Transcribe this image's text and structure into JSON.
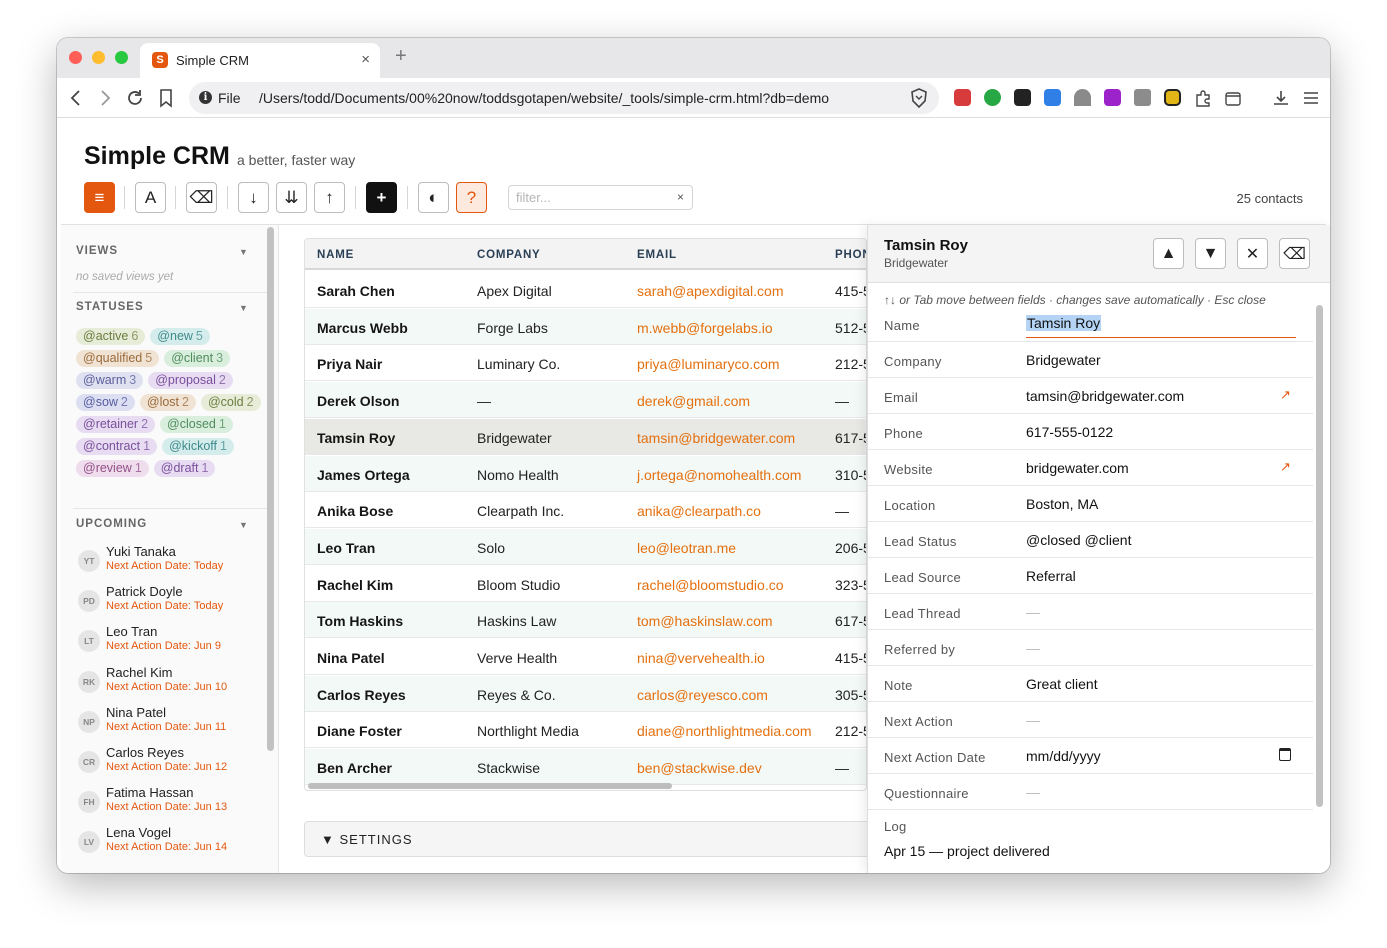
{
  "browser": {
    "tab_title": "Simple CRM",
    "tab_favicon": "S",
    "url_scheme": "File",
    "url": "/Users/todd/Documents/00%20now/toddsgotapen/website/_tools/simple-crm.html?db=demo"
  },
  "app": {
    "title": "Simple CRM",
    "subtitle": "a better, faster way",
    "filter_placeholder": "filter...",
    "contact_count": "25 contacts",
    "toolbar": {
      "menu_icon": "≡",
      "font_icon": "A",
      "clear_icon": "⌫",
      "sort_down_icon": "↓",
      "sort_double_icon": "⇊",
      "sort_up_icon": "↑",
      "add_icon": "+",
      "contrast_icon": "◐",
      "help_icon": "?",
      "filter_clear": "×"
    }
  },
  "sidebar": {
    "views_heading": "VIEWS",
    "views_empty": "no saved views yet",
    "statuses_heading": "STATUSES",
    "statuses": [
      {
        "tag": "@active",
        "count": "6",
        "bg": "#e6ecd8",
        "fg": "#6d7c3f"
      },
      {
        "tag": "@new",
        "count": "5",
        "bg": "#d5ecec",
        "fg": "#3e8a8a"
      },
      {
        "tag": "@qualified",
        "count": "5",
        "bg": "#f1e3d3",
        "fg": "#9a6a3a"
      },
      {
        "tag": "@client",
        "count": "3",
        "bg": "#d9eedd",
        "fg": "#4d8c5b"
      },
      {
        "tag": "@warm",
        "count": "3",
        "bg": "#dfe1f1",
        "fg": "#5a5f9a"
      },
      {
        "tag": "@proposal",
        "count": "2",
        "bg": "#e7dcf1",
        "fg": "#7a4f9c"
      },
      {
        "tag": "@sow",
        "count": "2",
        "bg": "#dcdff2",
        "fg": "#555c9e"
      },
      {
        "tag": "@lost",
        "count": "2",
        "bg": "#f1e3d3",
        "fg": "#9a6a3a"
      },
      {
        "tag": "@cold",
        "count": "2",
        "bg": "#e6ecd8",
        "fg": "#6d7c3f"
      },
      {
        "tag": "@retainer",
        "count": "2",
        "bg": "#e7dcf1",
        "fg": "#7a4f9c"
      },
      {
        "tag": "@closed",
        "count": "1",
        "bg": "#d9eedd",
        "fg": "#4d8c5b"
      },
      {
        "tag": "@contract",
        "count": "1",
        "bg": "#e7dcf1",
        "fg": "#7a4f9c"
      },
      {
        "tag": "@kickoff",
        "count": "1",
        "bg": "#d5ecec",
        "fg": "#3e8a8a"
      },
      {
        "tag": "@review",
        "count": "1",
        "bg": "#efdcec",
        "fg": "#934f88"
      },
      {
        "tag": "@draft",
        "count": "1",
        "bg": "#e7dcf1",
        "fg": "#7a4f9c"
      }
    ],
    "upcoming_heading": "UPCOMING",
    "upcoming": [
      {
        "initials": "YT",
        "name": "Yuki Tanaka",
        "date": "Next Action Date: Today"
      },
      {
        "initials": "PD",
        "name": "Patrick Doyle",
        "date": "Next Action Date: Today"
      },
      {
        "initials": "LT",
        "name": "Leo Tran",
        "date": "Next Action Date: Jun 9"
      },
      {
        "initials": "RK",
        "name": "Rachel Kim",
        "date": "Next Action Date: Jun 10"
      },
      {
        "initials": "NP",
        "name": "Nina Patel",
        "date": "Next Action Date: Jun 11"
      },
      {
        "initials": "CR",
        "name": "Carlos Reyes",
        "date": "Next Action Date: Jun 12"
      },
      {
        "initials": "FH",
        "name": "Fatima Hassan",
        "date": "Next Action Date: Jun 13"
      },
      {
        "initials": "LV",
        "name": "Lena Vogel",
        "date": "Next Action Date: Jun 14"
      }
    ]
  },
  "table": {
    "columns": [
      "NAME",
      "COMPANY",
      "EMAIL",
      "PHON"
    ],
    "rows": [
      {
        "name": "Sarah Chen",
        "company": "Apex Digital",
        "email": "sarah@apexdigital.com",
        "phone": "415-5"
      },
      {
        "name": "Marcus Webb",
        "company": "Forge Labs",
        "email": "m.webb@forgelabs.io",
        "phone": "512-5"
      },
      {
        "name": "Priya Nair",
        "company": "Luminary Co.",
        "email": "priya@luminaryco.com",
        "phone": "212-5"
      },
      {
        "name": "Derek Olson",
        "company": "—",
        "email": "derek@gmail.com",
        "phone": "—"
      },
      {
        "name": "Tamsin Roy",
        "company": "Bridgewater",
        "email": "tamsin@bridgewater.com",
        "phone": "617-5"
      },
      {
        "name": "James Ortega",
        "company": "Nomo Health",
        "email": "j.ortega@nomohealth.com",
        "phone": "310-5"
      },
      {
        "name": "Anika Bose",
        "company": "Clearpath Inc.",
        "email": "anika@clearpath.co",
        "phone": "—"
      },
      {
        "name": "Leo Tran",
        "company": "Solo",
        "email": "leo@leotran.me",
        "phone": "206-5"
      },
      {
        "name": "Rachel Kim",
        "company": "Bloom Studio",
        "email": "rachel@bloomstudio.co",
        "phone": "323-5"
      },
      {
        "name": "Tom Haskins",
        "company": "Haskins Law",
        "email": "tom@haskinslaw.com",
        "phone": "617-5"
      },
      {
        "name": "Nina Patel",
        "company": "Verve Health",
        "email": "nina@vervehealth.io",
        "phone": "415-5"
      },
      {
        "name": "Carlos Reyes",
        "company": "Reyes & Co.",
        "email": "carlos@reyesco.com",
        "phone": "305-5"
      },
      {
        "name": "Diane Foster",
        "company": "Northlight Media",
        "email": "diane@northlightmedia.com",
        "phone": "212-5"
      },
      {
        "name": "Ben Archer",
        "company": "Stackwise",
        "email": "ben@stackwise.dev",
        "phone": "—"
      }
    ],
    "selected_index": 4
  },
  "settings_label": "▼ SETTINGS",
  "detail": {
    "name": "Tamsin Roy",
    "company": "Bridgewater",
    "hint_keys": "↑↓",
    "hint": " or Tab move between fields · changes save automatically · Esc close",
    "fields": [
      {
        "label": "Name",
        "value": "Tamsin Roy"
      },
      {
        "label": "Company",
        "value": "Bridgewater"
      },
      {
        "label": "Email",
        "value": "tamsin@bridgewater.com"
      },
      {
        "label": "Phone",
        "value": "617-555-0122"
      },
      {
        "label": "Website",
        "value": "bridgewater.com"
      },
      {
        "label": "Location",
        "value": "Boston, MA"
      },
      {
        "label": "Lead Status",
        "value": "@closed @client"
      },
      {
        "label": "Lead Source",
        "value": "Referral"
      },
      {
        "label": "Lead Thread",
        "value": "—"
      },
      {
        "label": "Referred by",
        "value": "—"
      },
      {
        "label": "Note",
        "value": "Great client"
      },
      {
        "label": "Next Action",
        "value": "—"
      },
      {
        "label": "Next Action Date",
        "value": "mm/dd/yyyy"
      },
      {
        "label": "Questionnaire",
        "value": "—"
      }
    ],
    "log_label": "Log",
    "log_value": "Apr 15 — project delivered",
    "link_icon": "↗"
  }
}
